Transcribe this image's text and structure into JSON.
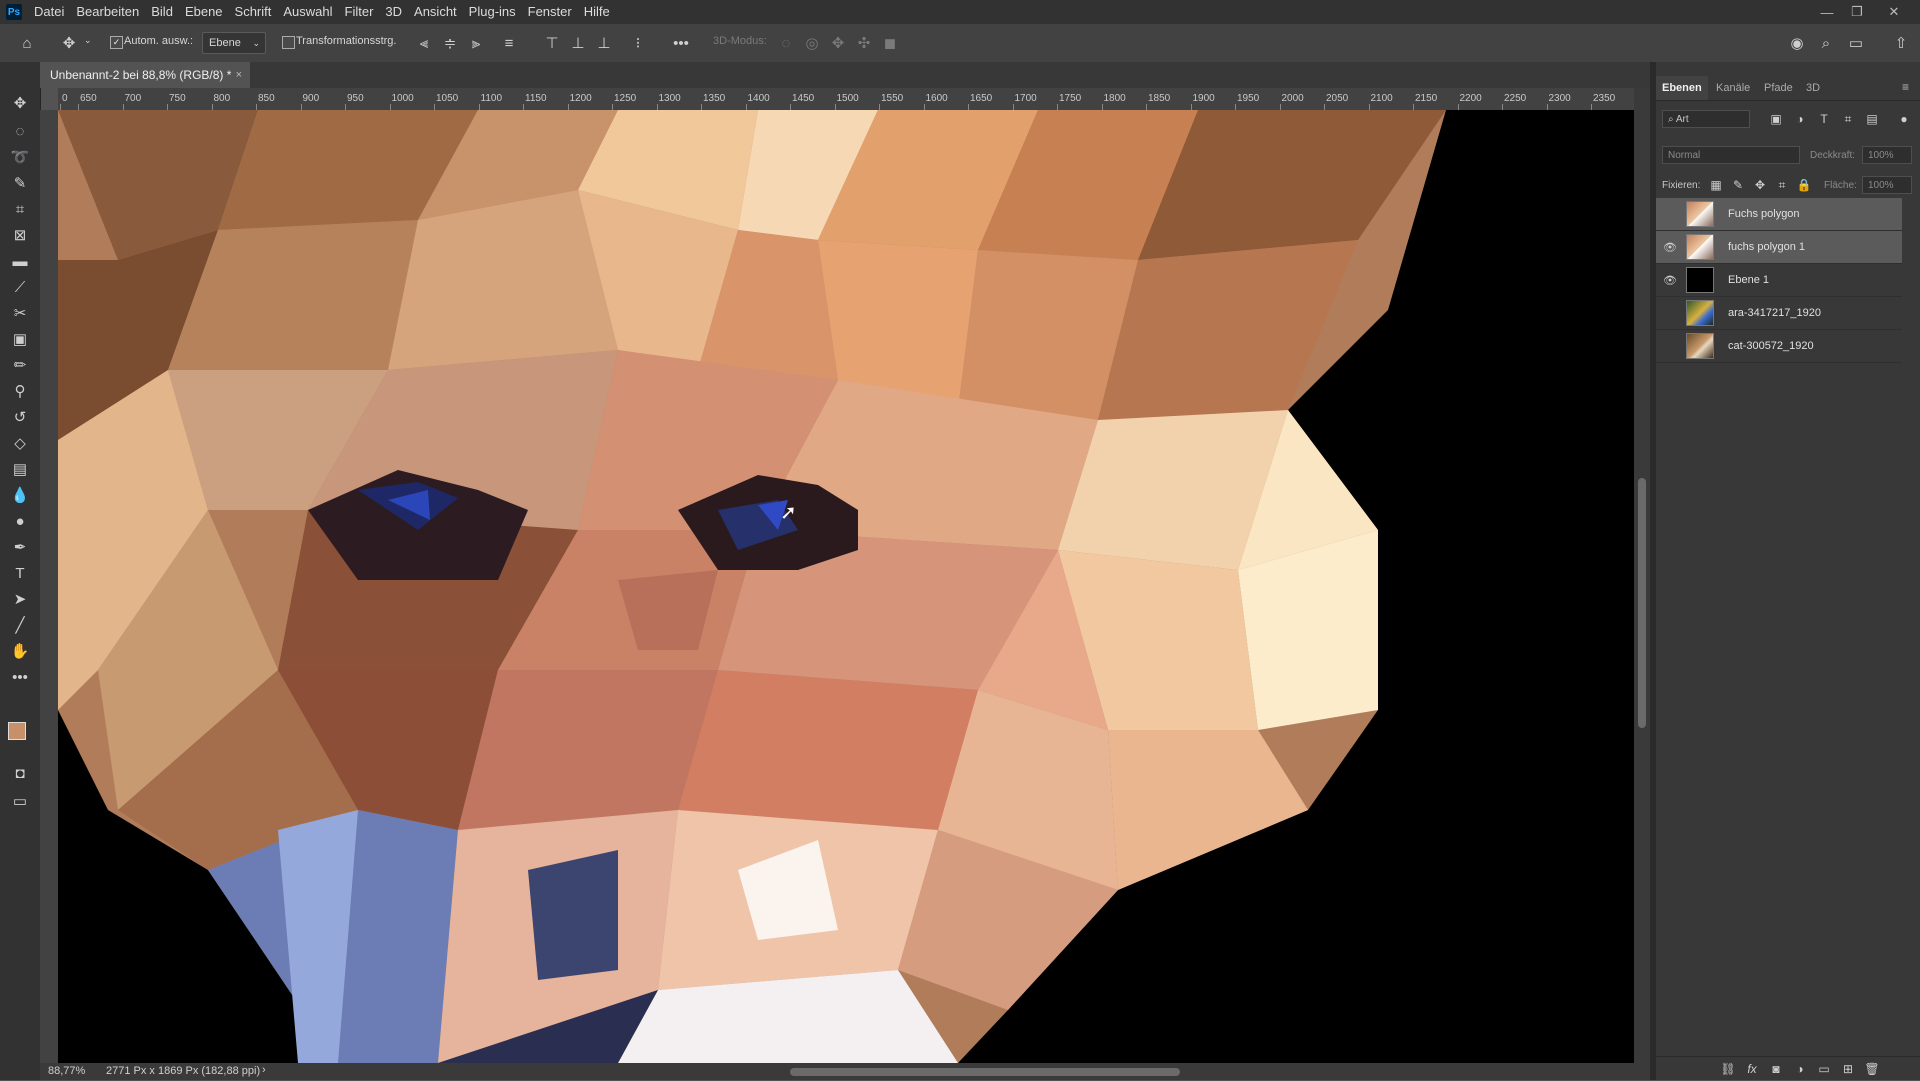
{
  "menubar": {
    "logo": "Ps",
    "items": [
      "Datei",
      "Bearbeiten",
      "Bild",
      "Ebene",
      "Schrift",
      "Auswahl",
      "Filter",
      "3D",
      "Ansicht",
      "Plug-ins",
      "Fenster",
      "Hilfe"
    ]
  },
  "options": {
    "auto_select_label": "Autom. ausw.:",
    "auto_select_checked": true,
    "target_select": "Ebene",
    "transform_label": "Transformationsstrg.",
    "transform_checked": false,
    "mode3d_label": "3D-Modus:"
  },
  "document": {
    "tab_title": "Unbenannt-2 bei 88,8% (RGB/8) *",
    "close": "×"
  },
  "ruler": {
    "labels": [
      "0",
      "650",
      "700",
      "750",
      "800",
      "850",
      "900",
      "950",
      "1000",
      "1050",
      "1100",
      "1150",
      "1200",
      "1250",
      "1300",
      "1350",
      "1400",
      "1450",
      "1500",
      "1550",
      "1600",
      "1650",
      "1700",
      "1750",
      "1800",
      "1850",
      "1900",
      "1950",
      "2000",
      "2050",
      "2100",
      "2150",
      "2200",
      "2250",
      "2300",
      "2350"
    ]
  },
  "status": {
    "zoom": "88,77%",
    "doc_info": "2771 Px x 1869 Px (182,88 ppi)",
    "arrow": "›"
  },
  "panel": {
    "tabs": [
      "Ebenen",
      "Kanäle",
      "Pfade",
      "3D"
    ],
    "active_tab": "Ebenen",
    "filter_kind": "Art",
    "blend_mode": "Normal",
    "opacity_label": "Deckkraft:",
    "opacity_value": "100%",
    "lock_label": "Fixieren:",
    "fill_label": "Fläche:",
    "fill_value": "100%",
    "layers": [
      {
        "name": "Fuchs polygon",
        "visible": false,
        "selected": true,
        "thumb": "fox"
      },
      {
        "name": "fuchs polygon 1",
        "visible": true,
        "selected": true,
        "thumb": "fox"
      },
      {
        "name": "Ebene 1",
        "visible": true,
        "selected": false,
        "thumb": "black"
      },
      {
        "name": "ara-3417217_1920",
        "visible": false,
        "selected": false,
        "thumb": "parrot"
      },
      {
        "name": "cat-300572_1920",
        "visible": false,
        "selected": false,
        "thumb": "cat"
      }
    ]
  }
}
